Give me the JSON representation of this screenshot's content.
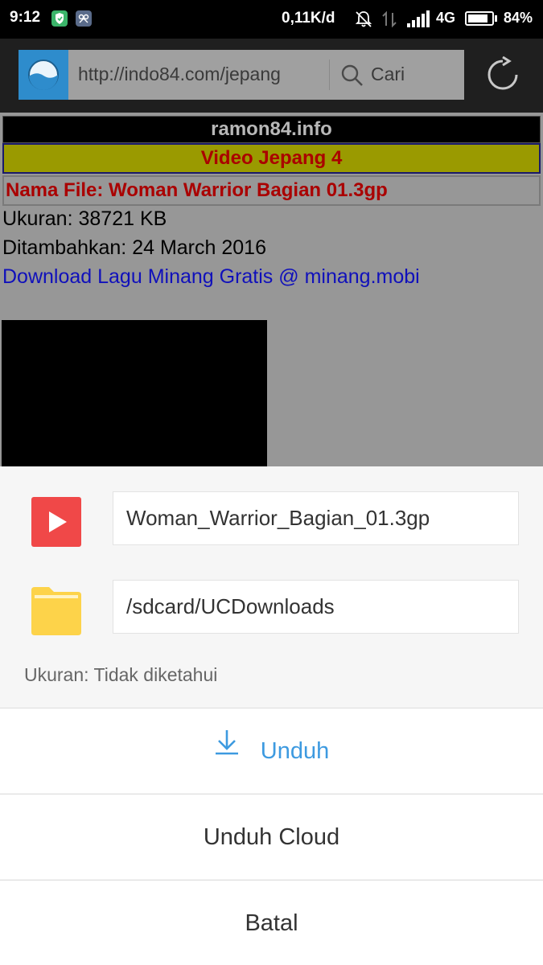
{
  "status_bar": {
    "time": "9:12",
    "network_speed": "0,11K/d",
    "network_type": "4G",
    "battery_percent": "84%",
    "battery_level": 0.84,
    "icons": [
      "shield-app-icon",
      "gallery-app-icon",
      "notifications-off-icon",
      "data-transfer-icon",
      "signal-icon",
      "battery-icon"
    ]
  },
  "browser": {
    "url": "http://indo84.com/jepang",
    "search_label": "Cari",
    "icons": [
      "site-icon",
      "search-icon",
      "reload-icon"
    ]
  },
  "page": {
    "site_title": "ramon84.info",
    "category": "Video Jepang 4",
    "file_name_label": "Nama File: Woman Warrior Bagian 01.3gp",
    "size_line": "Ukuran: 38721 KB",
    "added_line": "Ditambahkan: 24 March 2016",
    "link_text": "Download Lagu Minang Gratis @ minang.mobi"
  },
  "download_sheet": {
    "file_name": "Woman_Warrior_Bagian_01.3gp",
    "folder_path": "/sdcard/UCDownloads",
    "size_text": "Ukuran: Tidak diketahui",
    "download_label": "Unduh",
    "cloud_download_label": "Unduh Cloud",
    "cancel_label": "Batal",
    "icons": [
      "video-file-icon",
      "folder-icon",
      "download-icon"
    ]
  },
  "colors": {
    "accent_blue": "#3d9ae0",
    "file_icon_red": "#f04848",
    "folder_yellow": "#fdd34a",
    "page_title_red": "#aa0000",
    "category_bar": "#9a9a00",
    "link_blue": "#1010bb"
  }
}
